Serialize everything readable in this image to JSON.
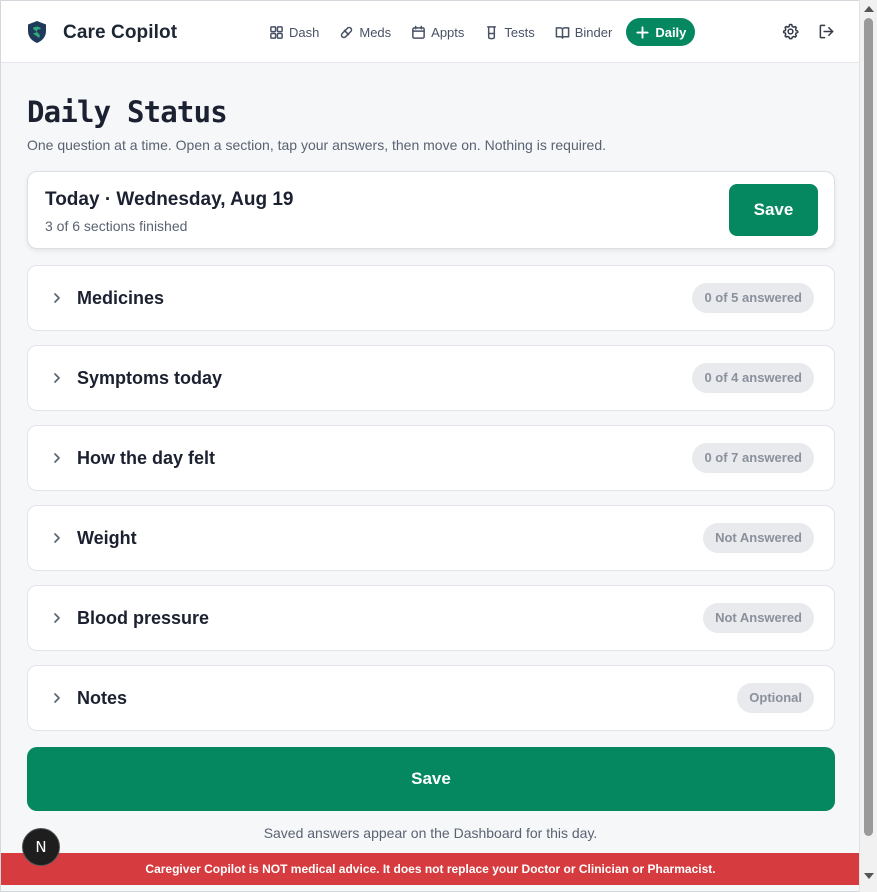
{
  "header": {
    "brand": "Care Copilot",
    "nav": [
      {
        "label": "Dash",
        "icon": "grid-icon"
      },
      {
        "label": "Meds",
        "icon": "pill-icon"
      },
      {
        "label": "Appts",
        "icon": "calendar-icon"
      },
      {
        "label": "Tests",
        "icon": "test-tube-icon"
      },
      {
        "label": "Binder",
        "icon": "book-icon"
      },
      {
        "label": "Daily",
        "icon": "plus-icon",
        "active": true
      }
    ],
    "settings_icon": "gear-icon",
    "logout_icon": "logout-icon"
  },
  "page": {
    "title": "Daily Status",
    "subtitle": "One question at a time. Open a section, tap your answers, then move on. Nothing is required."
  },
  "today": {
    "title": "Today · Wednesday, Aug 19",
    "progress": "3 of 6 sections finished",
    "save_label": "Save"
  },
  "sections": [
    {
      "label": "Medicines",
      "status": "0 of 5 answered"
    },
    {
      "label": "Symptoms today",
      "status": "0 of 4 answered"
    },
    {
      "label": "How the day felt",
      "status": "0 of 7 answered"
    },
    {
      "label": "Weight",
      "status": "Not Answered"
    },
    {
      "label": "Blood pressure",
      "status": "Not Answered"
    },
    {
      "label": "Notes",
      "status": "Optional"
    }
  ],
  "bottom": {
    "save_label": "Save",
    "footnote": "Saved answers appear on the Dashboard for this day.",
    "disclaimer": "Caregiver Copilot is NOT medical advice. It does not replace your Doctor or Clinician or Pharmacist.",
    "dev_badge": "N"
  },
  "colors": {
    "accent": "#05875f",
    "disclaimer_bg": "#d63c3f",
    "badge_bg": "#e8eaed"
  }
}
